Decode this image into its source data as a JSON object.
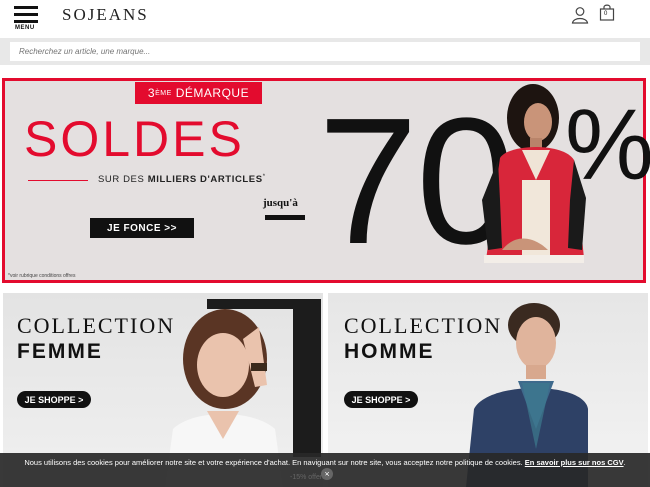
{
  "header": {
    "menu_label": "MENU",
    "logo": "SOJEANS",
    "bag_count": "0"
  },
  "search": {
    "placeholder": "Recherchez un article, une marque..."
  },
  "hero": {
    "badge_number": "3",
    "badge_sup": "ÈME",
    "badge_text": "DÉMARQUE",
    "title": "SOLDES",
    "subtitle_prefix": "SUR DES",
    "subtitle_bold": "MILLIERS D'ARTICLES",
    "subtitle_asterisk": "*",
    "cta": "JE FONCE >>",
    "jusqua": "jusqu'à",
    "big_number": "70",
    "percent": "%",
    "footnote": "*voir rubrique conditions offres"
  },
  "cards": [
    {
      "line1": "COLLECTION",
      "line2": "FEMME",
      "cta": "JE SHOPPE  >"
    },
    {
      "line1": "COLLECTION",
      "line2": "HOMME",
      "cta": "JE SHOPPE  >"
    }
  ],
  "cookie": {
    "text": "Nous utilisons des cookies pour améliorer notre site et votre expérience d'achat. En naviguant sur notre site, vous acceptez notre politique de cookies.",
    "link": "En savoir plus sur nos CGV",
    "close": "×",
    "underlay": "-15% offerts"
  },
  "colors": {
    "brand_red": "#e30b2e",
    "black": "#111111"
  }
}
